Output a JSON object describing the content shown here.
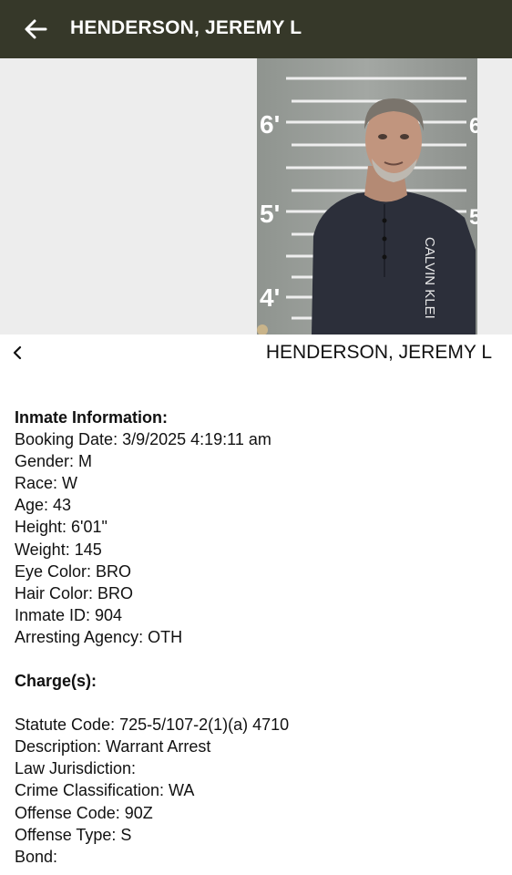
{
  "app_bar": {
    "title": "HENDERSON, JEREMY L",
    "back_icon": "arrow-left-icon"
  },
  "photo": {
    "height_marks": [
      "6'",
      "5'",
      "4'",
      "6",
      "5"
    ],
    "shirt_text": "CALVIN KLEI"
  },
  "detail_header": {
    "prev_icon": "chevron-left-icon",
    "title": "HENDERSON, JEREMY L"
  },
  "inmate_info": {
    "heading": "Inmate Information:",
    "rows": [
      "Booking Date: 3/9/2025 4:19:11 am",
      "Gender: M",
      "Race: W",
      "Age: 43",
      "Height: 6'01\"",
      "Weight: 145",
      "Eye Color: BRO",
      "Hair Color: BRO",
      "Inmate ID: 904",
      "Arresting Agency: OTH"
    ]
  },
  "charges": {
    "heading": "Charge(s):",
    "rows": [
      "Statute Code: 725-5/107-2(1)(a) 4710",
      "Description: Warrant Arrest",
      "Law Jurisdiction:",
      "Crime Classification: WA",
      "Offense Code: 90Z",
      "Offense Type: S",
      "Bond:"
    ]
  },
  "colors": {
    "app_bar_bg": "#363829",
    "photo_bg": "#ededed",
    "text": "#111111"
  }
}
